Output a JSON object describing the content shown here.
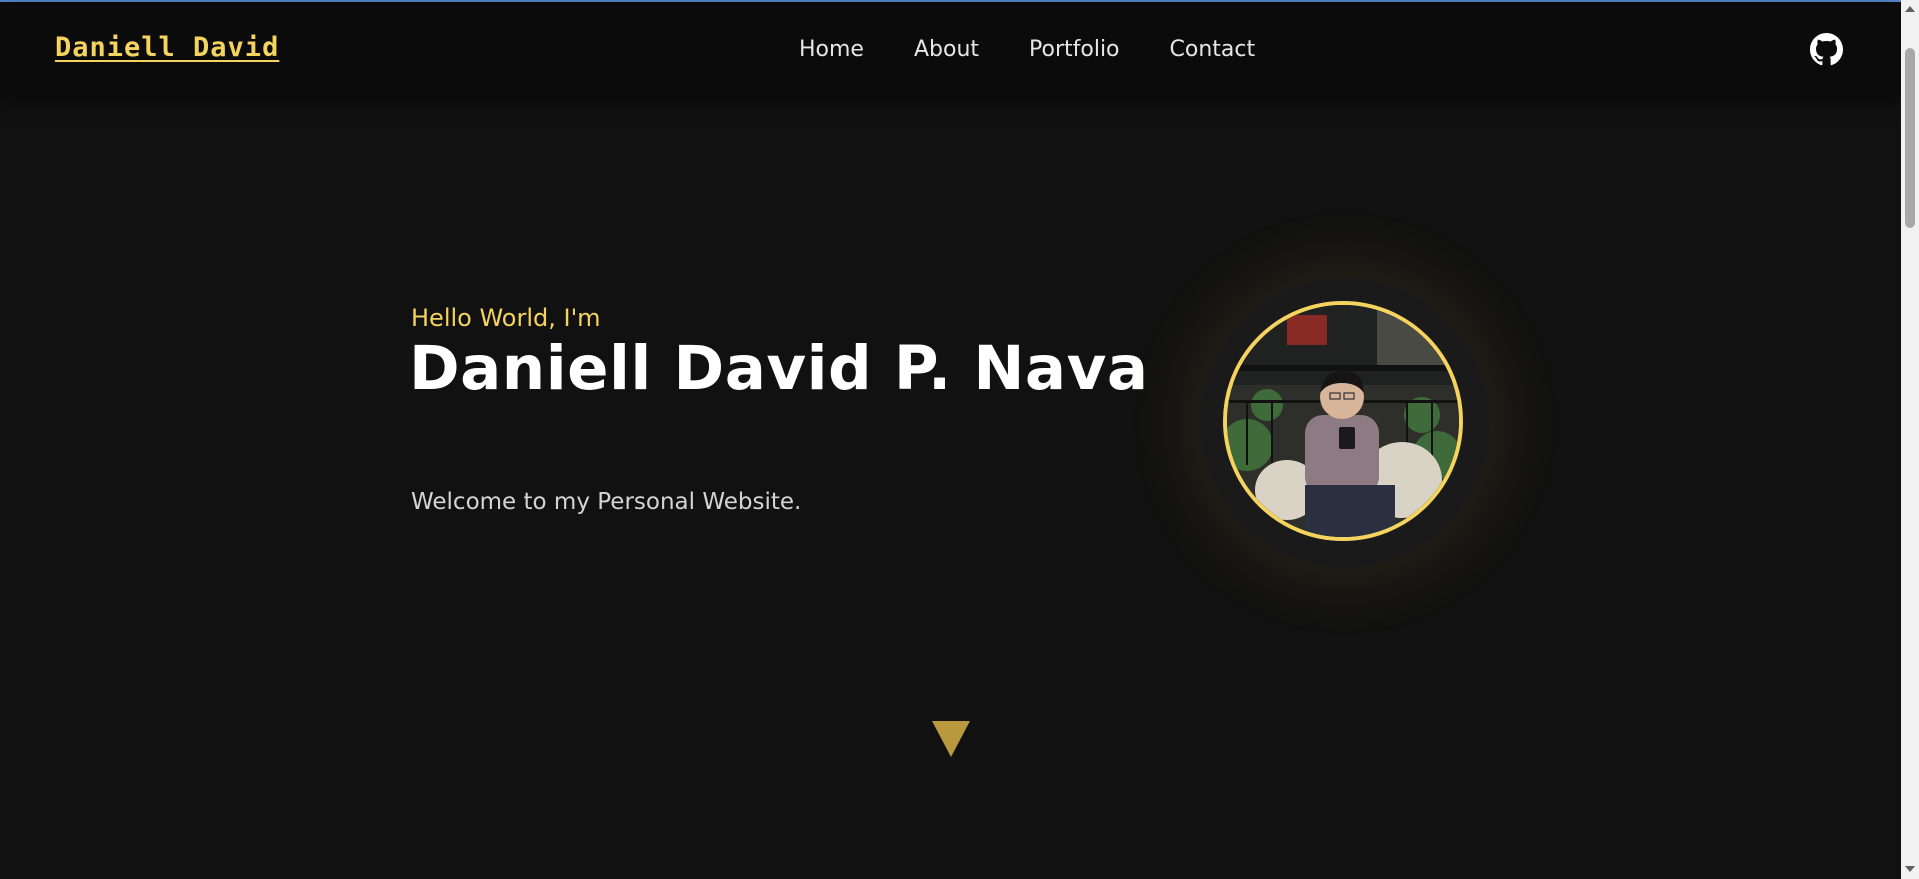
{
  "navbar": {
    "brand": "Daniell David",
    "links": [
      "Home",
      "About",
      "Portfolio",
      "Contact"
    ],
    "github_icon": "github-icon"
  },
  "hero": {
    "greeting": "Hello World, I'm",
    "name": "Daniell David P. Nava",
    "tagline": "Welcome to my Personal Website.",
    "avatar_icon": "profile-photo",
    "scroll_icon": "triangle-down-icon"
  },
  "colors": {
    "accent": "#f4d35e",
    "background": "#111111",
    "navbar": "#0b0b0b",
    "text": "#ffffff"
  }
}
